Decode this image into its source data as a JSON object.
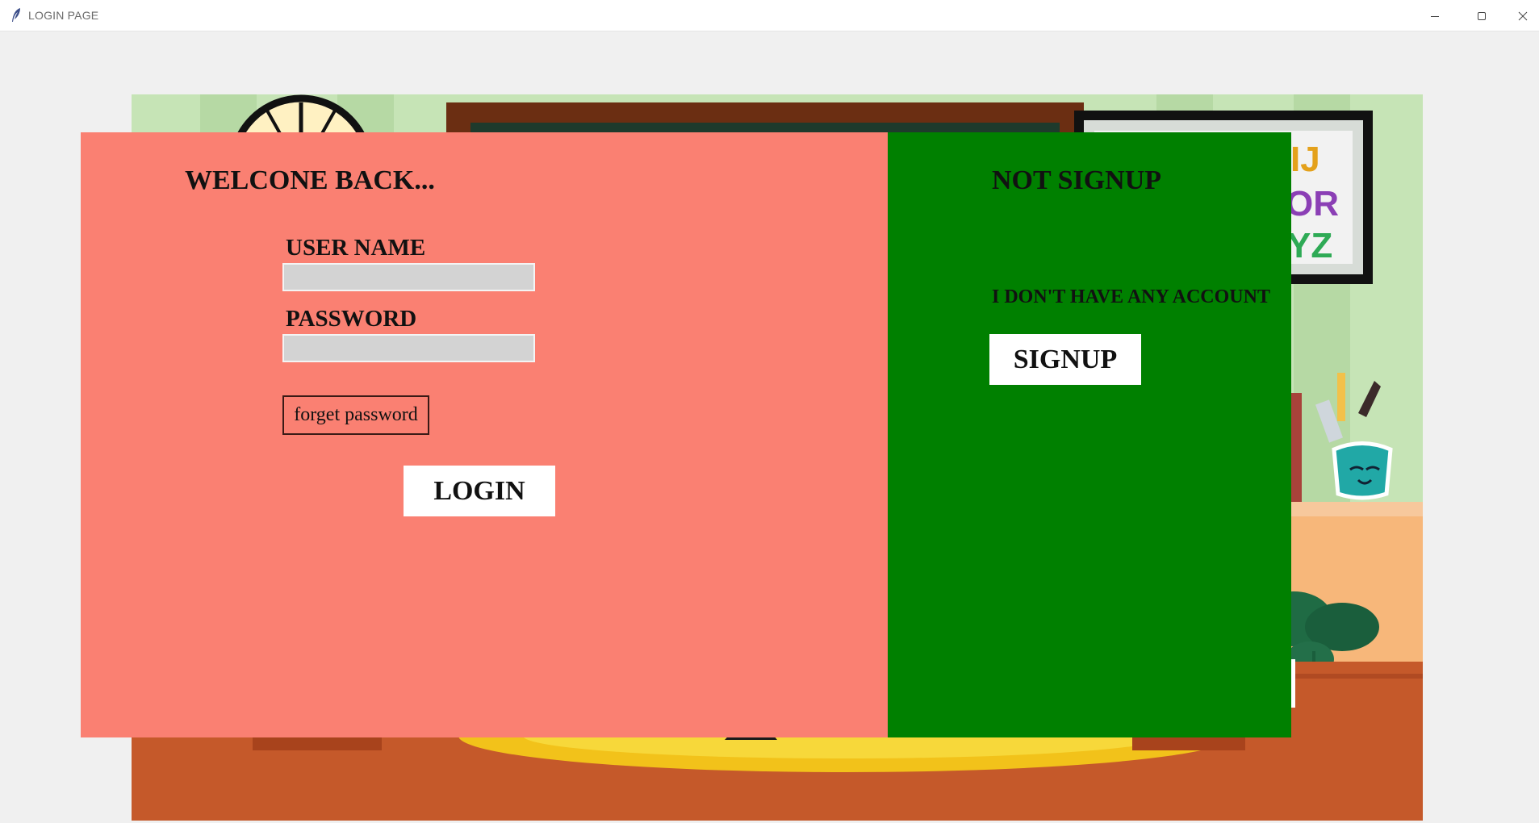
{
  "window": {
    "title": "LOGIN PAGE",
    "app_icon": "feather-icon",
    "controls": [
      "minimize-icon",
      "maximize-icon",
      "close-icon"
    ]
  },
  "login": {
    "heading": "WELCONE BACK...",
    "username_label": "USER NAME",
    "username_value": "",
    "password_label": "PASSWORD",
    "password_value": "",
    "forget_label": "forget password",
    "login_label": "LOGIN",
    "panel_color": "#fa8072"
  },
  "signup": {
    "heading": "NOT SIGNUP",
    "prompt": "I DON'T HAVE ANY ACCOUNT",
    "signup_label": "SIGNUP",
    "panel_color": "#008000"
  }
}
